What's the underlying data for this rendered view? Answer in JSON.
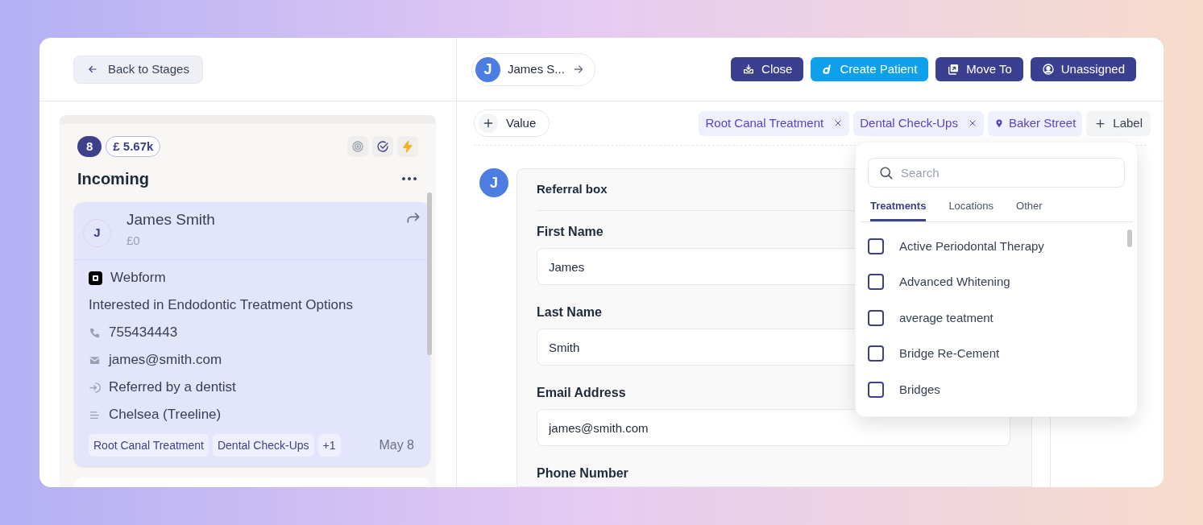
{
  "back_button": {
    "label": "Back to Stages"
  },
  "column": {
    "count": "8",
    "value": "£ 5.67k",
    "title": "Incoming"
  },
  "lead_card": {
    "initial": "J",
    "name": "James Smith",
    "amount": "£0",
    "source": "Webform",
    "interest": "Interested in Endodontic Treatment Options",
    "phone": "755434443",
    "email": "james@smith.com",
    "referral": "Referred by a dentist",
    "location": "Chelsea (Treeline)",
    "tags": [
      "Root Canal Treatment",
      "Dental Check-Ups",
      "+1"
    ],
    "date": "May 8"
  },
  "header": {
    "contact": {
      "initial": "J",
      "name": "James S..."
    },
    "buttons": [
      {
        "kind": "close",
        "label": "Close"
      },
      {
        "kind": "create",
        "label": "Create Patient"
      },
      {
        "kind": "move",
        "label": "Move To"
      },
      {
        "kind": "assign",
        "label": "Unassigned"
      }
    ]
  },
  "labels_bar": {
    "value_button": "Value",
    "labels": [
      {
        "kind": "treatment",
        "label": "Root Canal Treatment"
      },
      {
        "kind": "treatment",
        "label": "Dental Check-Ups"
      },
      {
        "kind": "location",
        "label": "Baker Street"
      }
    ],
    "add_label": "Label"
  },
  "form": {
    "avatar": "J",
    "title": "Referral box",
    "fields": [
      {
        "label": "First Name",
        "value": "James"
      },
      {
        "label": "Last Name",
        "value": "Smith"
      },
      {
        "label": "Email Address",
        "value": "james@smith.com"
      },
      {
        "label": "Phone Number"
      }
    ]
  },
  "label_picker": {
    "search": {
      "placeholder": "Search"
    },
    "tabs": [
      {
        "label": "Treatments",
        "selected": true
      },
      {
        "label": "Locations",
        "selected": false
      },
      {
        "label": "Other",
        "selected": false
      }
    ],
    "options": [
      {
        "label": "Active Periodontal Therapy",
        "checked": false
      },
      {
        "label": "Advanced Whitening",
        "checked": false
      },
      {
        "label": "average teatment",
        "checked": false
      },
      {
        "label": "Bridge Re-Cement",
        "checked": false
      },
      {
        "label": "Bridges",
        "checked": false
      }
    ]
  }
}
